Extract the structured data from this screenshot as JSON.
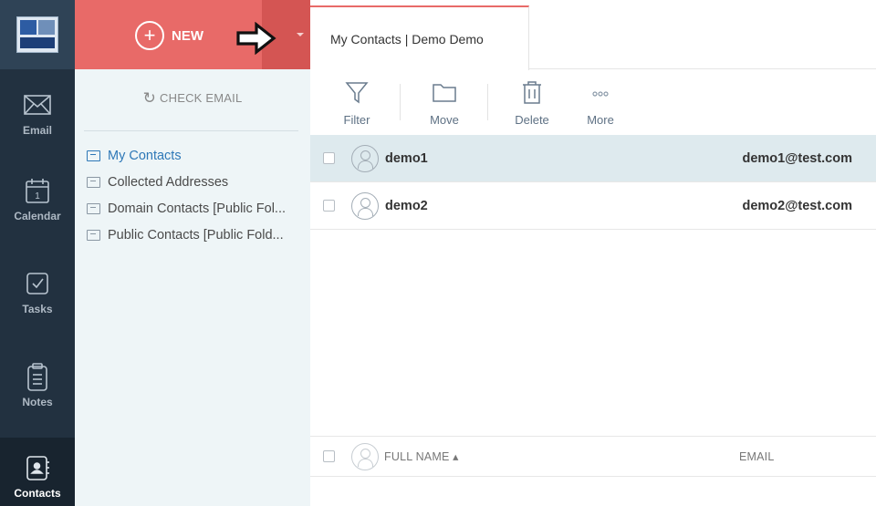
{
  "nav": {
    "items": [
      {
        "label": "Email",
        "icon": "envelope-icon"
      },
      {
        "label": "Calendar",
        "icon": "calendar-icon",
        "day": "1"
      },
      {
        "label": "Tasks",
        "icon": "checkbox-icon"
      },
      {
        "label": "Notes",
        "icon": "notepad-icon"
      },
      {
        "label": "Contacts",
        "icon": "contact-book-icon",
        "active": true
      }
    ]
  },
  "new_button": {
    "label": "NEW",
    "icon": "plus-circle-icon"
  },
  "check_email": {
    "label": "CHECK EMAIL",
    "icon": "refresh-icon"
  },
  "folders": [
    {
      "label": "My Contacts",
      "selected": true
    },
    {
      "label": "Collected Addresses"
    },
    {
      "label": "Domain Contacts [Public Fol..."
    },
    {
      "label": "Public Contacts [Public Fold..."
    }
  ],
  "tab": {
    "label": "My Contacts | Demo Demo"
  },
  "toolbar": {
    "filter": "Filter",
    "move": "Move",
    "delete": "Delete",
    "more": "More"
  },
  "contacts": [
    {
      "name": "demo1",
      "email": "demo1@test.com",
      "selected": true
    },
    {
      "name": "demo2",
      "email": "demo2@test.com"
    }
  ],
  "columns": {
    "full_name": "FULL NAME ▴",
    "email": "EMAIL"
  },
  "colors": {
    "accent": "#e86a68",
    "rail": "#223140",
    "selected_row": "#deeaee",
    "folder_selected": "#2e78b7"
  }
}
